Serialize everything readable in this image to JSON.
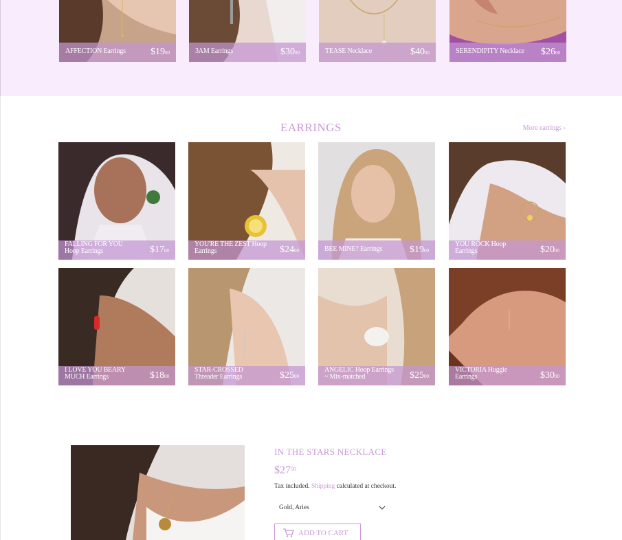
{
  "colors": {
    "accent": "#c99ad6",
    "band": "#f9ecfd",
    "overlay": "#c496d2"
  },
  "top_products": [
    {
      "name": "AFFECTION Earrings",
      "price": "$19",
      "cents": "00"
    },
    {
      "name": "3AM Earrings",
      "price": "$30",
      "cents": "00"
    },
    {
      "name": "TEASE Necklace",
      "price": "$40",
      "cents": "00"
    },
    {
      "name": "SERENDIPITY Necklace",
      "price": "$26",
      "cents": "00"
    }
  ],
  "earrings": {
    "title": "EARRINGS",
    "more_link": "More earrings ›",
    "products": [
      {
        "name": "FALLING FOR YOU Hoop Earrings",
        "price": "$17",
        "cents": "00"
      },
      {
        "name": "YOU'RE THE ZEST Hoop Earrings",
        "price": "$24",
        "cents": "00"
      },
      {
        "name": "BEE MINE? Earrings",
        "price": "$19",
        "cents": "00"
      },
      {
        "name": "YOU ROCK Hoop Earrings",
        "price": "$20",
        "cents": "00"
      },
      {
        "name": "I LOVE YOU BEARY MUCH Earrings",
        "price": "$18",
        "cents": "00"
      },
      {
        "name": "STAR-CROSSED Threader Earrings",
        "price": "$25",
        "cents": "00"
      },
      {
        "name": "ANGELIC Hoop Earrings ~ Mix-matched",
        "price": "$25",
        "cents": "00"
      },
      {
        "name": "VICTORIA Huggie Earrings",
        "price": "$30",
        "cents": "00"
      }
    ]
  },
  "featured": {
    "title": "IN THE STARS NECKLACE",
    "price": "$27",
    "cents": "00",
    "tax_prefix": "Tax included.",
    "shipping_link": "Shipping",
    "tax_suffix": "calculated at checkout.",
    "variant": "Gold, Aries",
    "add_to_cart": "ADD TO CART"
  }
}
